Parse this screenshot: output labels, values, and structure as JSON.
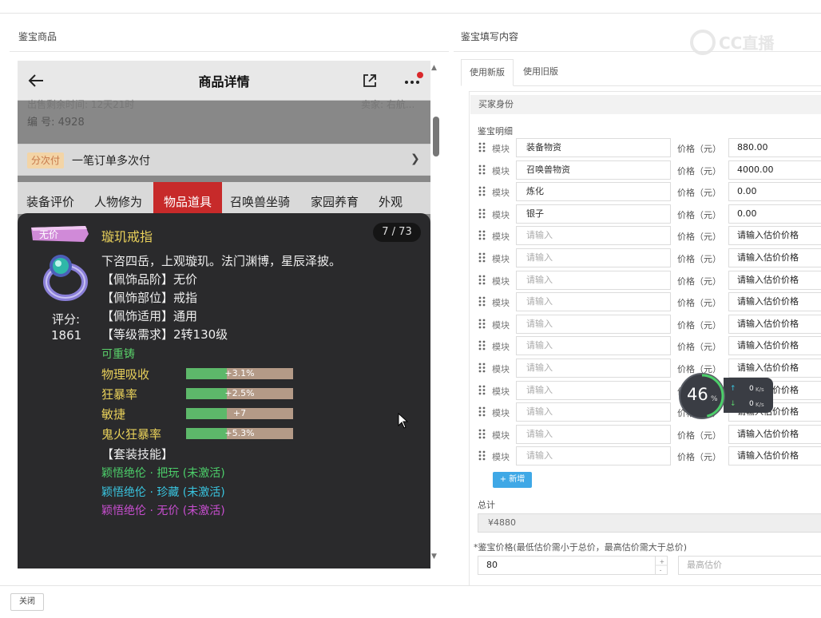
{
  "left": {
    "title": "鉴宝商品",
    "phone": {
      "header_title": "商品详情",
      "sale_time": "出售剩余时间: 12天21时",
      "seller": "卖家: 右航...",
      "serial": "编 号: 4928",
      "pay_badge": "分次付",
      "pay_text": "一笔订单多次付",
      "tabs": [
        "装备评价",
        "人物修为",
        "物品道具",
        "召唤兽坐骑",
        "家园养育",
        "外观"
      ],
      "active_tab": 2
    },
    "item": {
      "badge": "无价",
      "name": "璇玑戒指",
      "page": "7 / 73",
      "score_label": "评分:",
      "score": "1861",
      "desc": "下咨四岳，上观璇玑。法门渊博，星辰泽披。",
      "attrs": [
        "【佩饰品阶】无价",
        "【佩饰部位】戒指",
        "【佩饰适用】通用",
        "【等级需求】2转130级"
      ],
      "recast": "可重铸",
      "stats": [
        {
          "name": "物理吸收",
          "text": "+3.1%",
          "fill": 0.38
        },
        {
          "name": "狂暴率",
          "text": "+2.5%",
          "fill": 0.38
        },
        {
          "name": "敏捷",
          "text": "+7",
          "fill": 0.38
        },
        {
          "name": "鬼火狂暴率",
          "text": "+5.3%",
          "fill": 0.38
        }
      ],
      "set_title": "【套装技能】",
      "set_skills": [
        "颖悟绝伦 · 把玩 (未激活)",
        "颖悟绝伦 · 珍藏 (未激活)",
        "颖悟绝伦 · 无价 (未激活)"
      ]
    }
  },
  "right": {
    "title": "鉴宝填写内容",
    "watermark": "CC直播",
    "tabs": [
      "使用新版",
      "使用旧版"
    ],
    "buyer_section": "买家身份",
    "detail_label": "鉴宝明细",
    "module_label": "模块",
    "price_label": "价格（元）",
    "module_placeholder": "请输入",
    "price_placeholder": "请输入估价价格",
    "rows": [
      {
        "module": "装备物资",
        "price": "880.00"
      },
      {
        "module": "召唤兽物资",
        "price": "4000.00"
      },
      {
        "module": "炼化",
        "price": "0.00"
      },
      {
        "module": "银子",
        "price": "0.00"
      },
      {
        "module": "",
        "price": ""
      },
      {
        "module": "",
        "price": ""
      },
      {
        "module": "",
        "price": ""
      },
      {
        "module": "",
        "price": ""
      },
      {
        "module": "",
        "price": ""
      },
      {
        "module": "",
        "price": ""
      },
      {
        "module": "",
        "price": ""
      },
      {
        "module": "",
        "price": ""
      },
      {
        "module": "",
        "price": ""
      },
      {
        "module": "",
        "price": ""
      },
      {
        "module": "",
        "price": ""
      }
    ],
    "add_button": "+ 新增",
    "total_label": "总计",
    "total_value": "¥4880",
    "appraise_label": "*鉴宝价格(最低估价需小于总价，最高估价需大于总价)",
    "min_price": "80",
    "max_placeholder": "最高估价"
  },
  "speed_widget": {
    "percent": "46",
    "percent_sign": "%",
    "up": "0",
    "down": "0",
    "unit": "K/s",
    "level": 0.46
  },
  "footer": {
    "close_button": "关闭"
  }
}
